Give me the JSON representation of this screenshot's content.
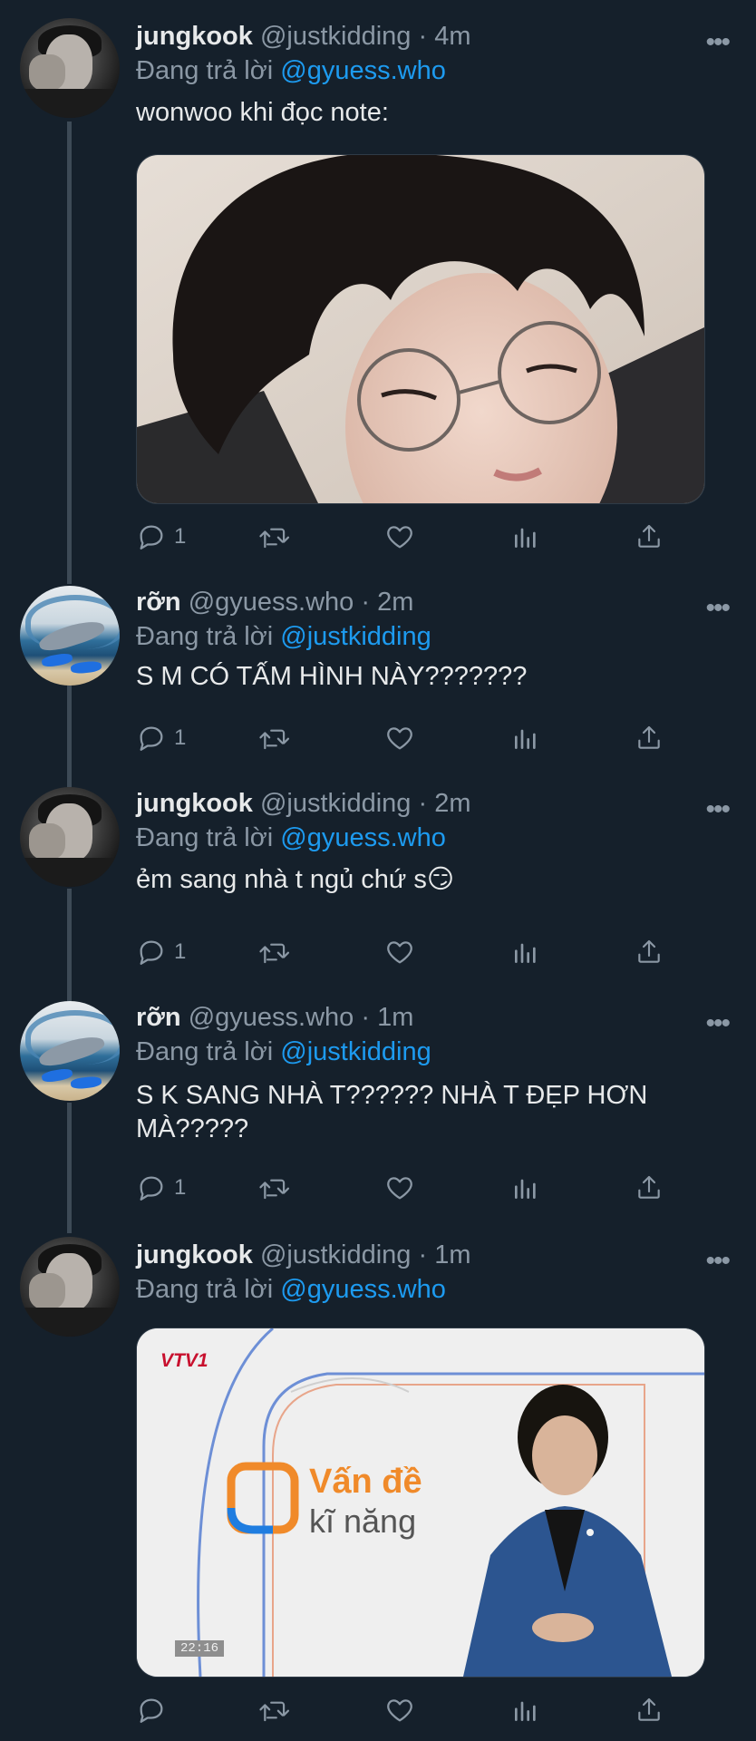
{
  "reply_label": "Đang trả lời",
  "tweets": [
    {
      "name": "jungkook",
      "handle": "@justkidding",
      "time": "4m",
      "reply_to": "@gyuess.who",
      "text": "wonwoo khi đọc note:",
      "reply_count": "1"
    },
    {
      "name": "rỡn",
      "handle": "@gyuess.who",
      "time": "2m",
      "reply_to": "@justkidding",
      "text": "S M CÓ TẤM HÌNH NÀY???????",
      "reply_count": "1"
    },
    {
      "name": "jungkook",
      "handle": "@justkidding",
      "time": "2m",
      "reply_to": "@gyuess.who",
      "text": "ẻm sang nhà t ngủ chứ s😏",
      "reply_count": "1"
    },
    {
      "name": "rỡn",
      "handle": "@gyuess.who",
      "time": "1m",
      "reply_to": "@justkidding",
      "text": "S K SANG NHÀ T?????? NHÀ T ĐẸP HƠN MÀ?????",
      "reply_count": "1"
    },
    {
      "name": "jungkook",
      "handle": "@justkidding",
      "time": "1m",
      "reply_to": "@gyuess.who",
      "text": "",
      "reply_count": ""
    }
  ],
  "media_tv": {
    "channel_logo": "VTV1",
    "title_line1": "Vấn đề",
    "title_line2": "kĩ năng",
    "timestamp": "22:16"
  },
  "icons": {
    "reply": "reply-icon",
    "retweet": "retweet-icon",
    "like": "heart-icon",
    "views": "views-icon",
    "share": "share-icon",
    "more": "more-icon"
  },
  "colors": {
    "background": "#15202b",
    "link": "#1d9bf0",
    "muted": "#8b98a5"
  }
}
